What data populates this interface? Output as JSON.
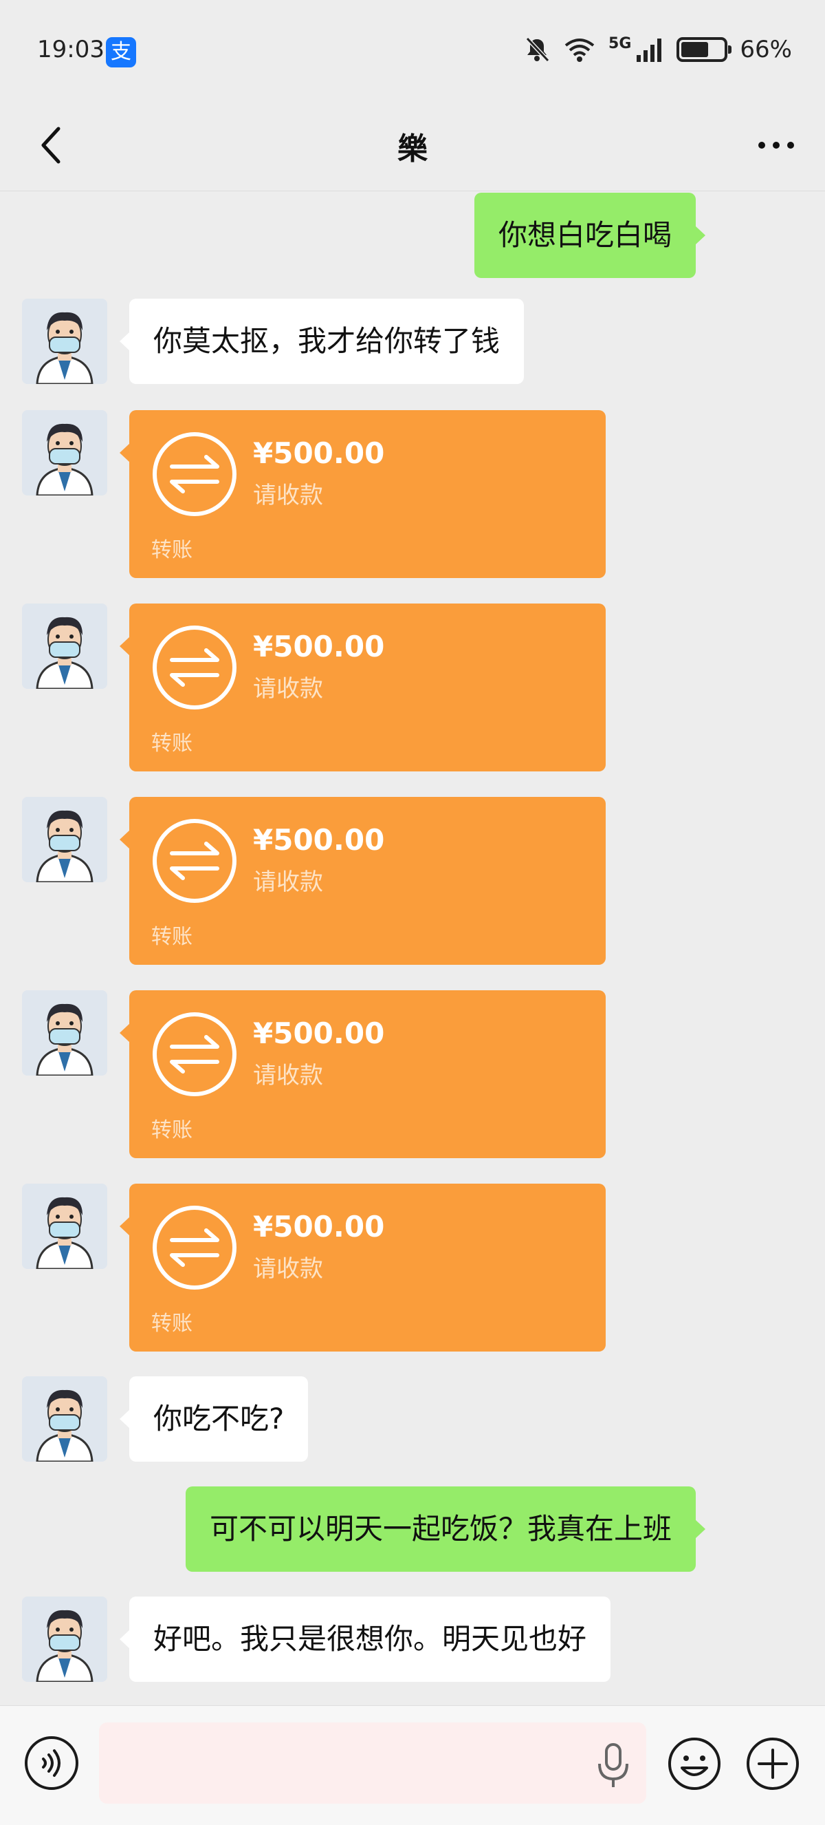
{
  "status_bar": {
    "time": "19:03",
    "alipay_badge": "支",
    "network": "5G",
    "battery": "66%",
    "battery_level": 0.66
  },
  "header": {
    "title": "樂"
  },
  "messages": [
    {
      "type": "text",
      "direction": "outgoing",
      "text": "你想白吃白喝"
    },
    {
      "type": "text",
      "direction": "incoming",
      "text": "你莫太抠，我才给你转了钱"
    },
    {
      "type": "transfer",
      "direction": "incoming",
      "amount": "¥500.00",
      "status": "请收款",
      "label": "转账"
    },
    {
      "type": "transfer",
      "direction": "incoming",
      "amount": "¥500.00",
      "status": "请收款",
      "label": "转账"
    },
    {
      "type": "transfer",
      "direction": "incoming",
      "amount": "¥500.00",
      "status": "请收款",
      "label": "转账"
    },
    {
      "type": "transfer",
      "direction": "incoming",
      "amount": "¥500.00",
      "status": "请收款",
      "label": "转账"
    },
    {
      "type": "transfer",
      "direction": "incoming",
      "amount": "¥500.00",
      "status": "请收款",
      "label": "转账"
    },
    {
      "type": "text",
      "direction": "incoming",
      "text": "你吃不吃?"
    },
    {
      "type": "text",
      "direction": "outgoing",
      "text": "可不可以明天一起吃饭？我真在上班"
    },
    {
      "type": "text",
      "direction": "incoming",
      "text": "好吧。我只是很想你。明天见也好"
    }
  ],
  "input_bar": {
    "value": "",
    "icons": [
      "voice-icon",
      "microphone-icon",
      "emoji-icon",
      "plus-icon"
    ]
  },
  "colors": {
    "outgoing_bubble": "#95ec69",
    "incoming_bubble": "#ffffff",
    "transfer_card": "#fa9d3b",
    "background": "#ededed"
  }
}
